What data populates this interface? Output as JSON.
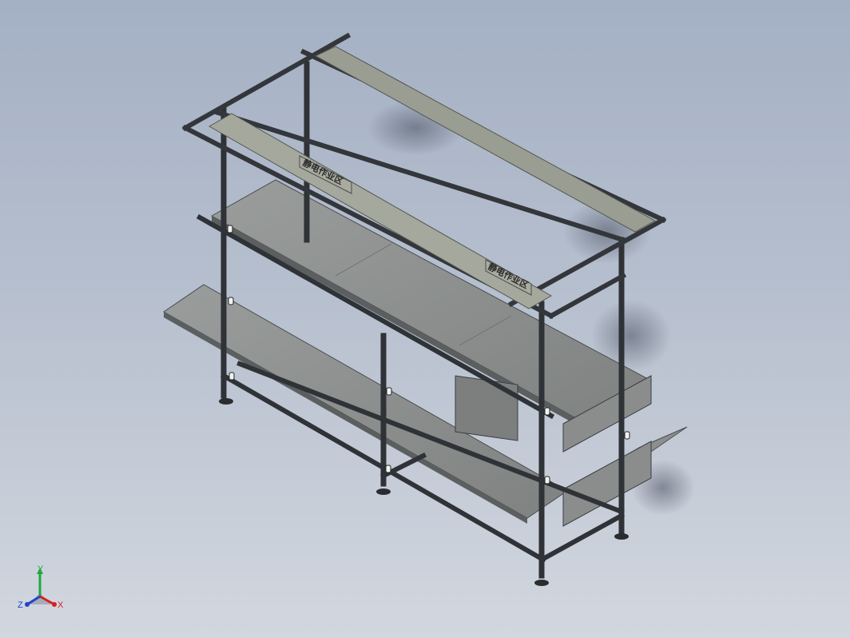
{
  "viewport": {
    "background_top": "#a4b0c4",
    "background_bottom": "#d2d7df"
  },
  "model": {
    "sign_text_upper": "静电作业区",
    "sign_text_lower": "静电作业区",
    "frame_color": "#3a3d42",
    "shelf_color": "#8f9290",
    "shelf_edge_color": "#5c5f60"
  },
  "triad": {
    "x_label": "X",
    "y_label": "Y",
    "z_label": "Z",
    "x_color": "#d62020",
    "y_color": "#1fa83a",
    "z_color": "#2442c8"
  }
}
